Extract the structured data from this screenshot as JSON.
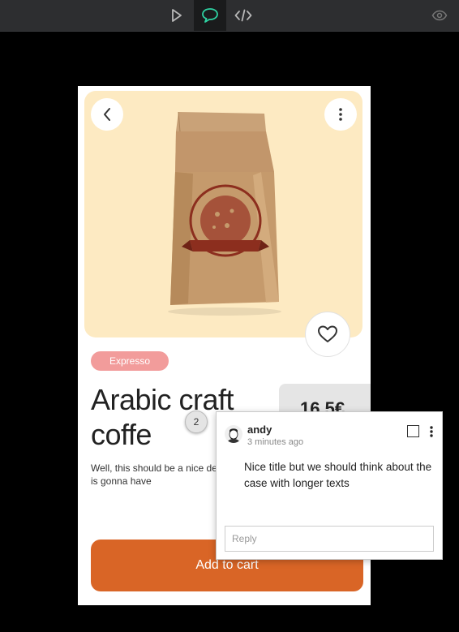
{
  "toolbar": {
    "icons": [
      "play-icon",
      "comment-icon",
      "code-icon",
      "eye-icon"
    ],
    "active": "comment-icon",
    "accent": "#2ed3a3"
  },
  "product": {
    "category": "Expresso",
    "title": "Arabic craft coffe",
    "price": "16.5€",
    "description": "Well, this should be a nice de taht someone is gonna have",
    "add_to_cart": "Add to cart",
    "bag_label_arc": "100% ORGANIC COLOMBIAN COFFEE",
    "bag_label_banner": "MARI NANUE",
    "colors": {
      "hero_bg": "#fdeac2",
      "tag_bg": "#f29c9b",
      "cart_bg": "#d96526"
    }
  },
  "annotation": {
    "pin_number": "2"
  },
  "comment": {
    "author": "andy",
    "time": "3 minutes ago",
    "text": "Nice title but we should think about the case with longer texts",
    "reply_placeholder": "Reply"
  }
}
